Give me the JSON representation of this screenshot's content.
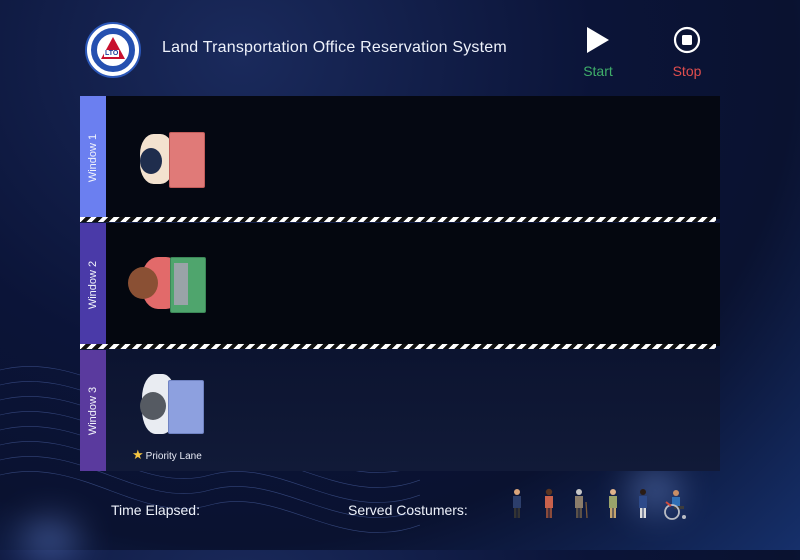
{
  "header": {
    "logo_text": "LTO",
    "title": "Land Transportation Office Reservation System",
    "start_label": "Start",
    "stop_label": "Stop"
  },
  "lanes": [
    {
      "label": "Window 1"
    },
    {
      "label": "Window 2"
    },
    {
      "label": "Window 3"
    }
  ],
  "priority_lane_label": "Priority Lane",
  "footer": {
    "time_elapsed_label": "Time Elapsed:",
    "served_label": "Served Costumers:"
  },
  "served_icons": [
    "man-in-suit-icon",
    "woman-icon",
    "elderly-man-with-cane-icon",
    "person-icon",
    "woman-with-bag-icon",
    "wheelchair-user-icon"
  ],
  "colors": {
    "start": "#3fae6a",
    "stop": "#e04e4e",
    "window1_tab": "#6b7ff0",
    "window2_tab": "#4a3aa8",
    "window3_tab": "#5a3a9e",
    "desk1": "#e07a78",
    "desk2": "#4fa56d",
    "desk3": "#8da0df"
  }
}
